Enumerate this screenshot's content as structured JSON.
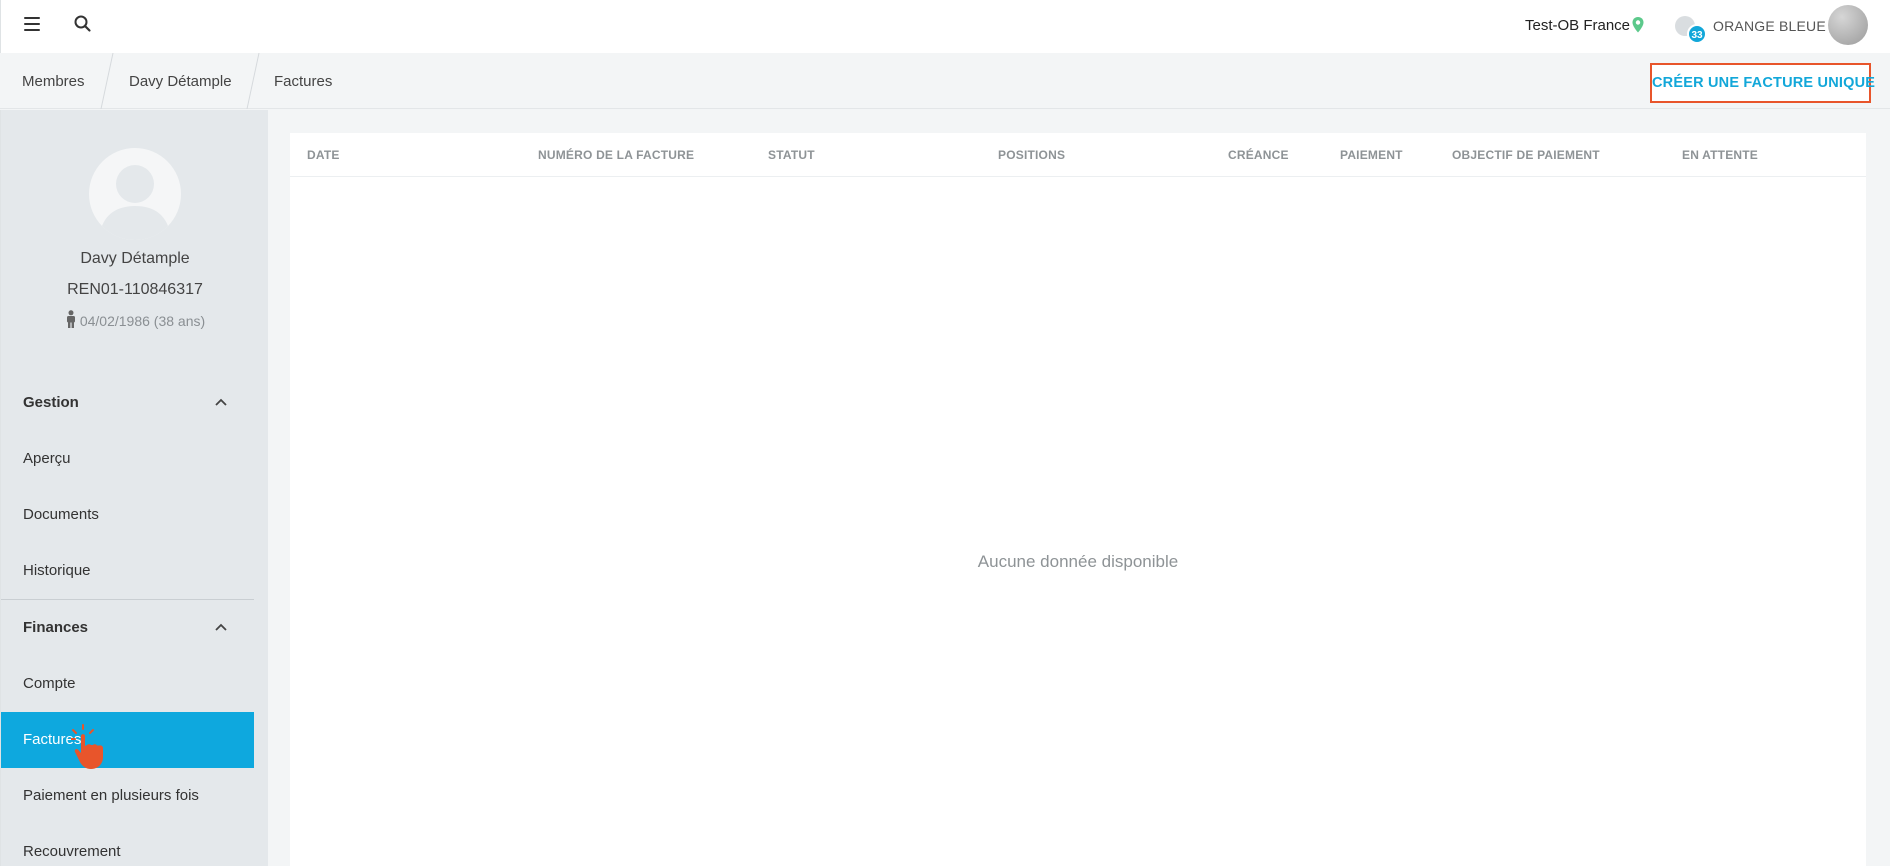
{
  "topbar": {
    "studio_name": "Test-OB France",
    "notification_count": "33",
    "brand_name": "ORANGE BLEUE",
    "icons": [
      "hamburger-menu-icon",
      "search-icon",
      "location-pin-icon",
      "notification-cloud-icon",
      "user-avatar"
    ],
    "pin_color": "#5cc98b"
  },
  "breadcrumb": {
    "items": [
      "Membres",
      "Davy Détample",
      "Factures"
    ]
  },
  "actions": {
    "create_invoice_label": "CRÉER UNE FACTURE UNIQUE",
    "accent_color": "#12a7d9",
    "highlight_color": "#e8552b"
  },
  "profile": {
    "name": "Davy Détample",
    "member_id": "REN01-110846317",
    "birthdate": "04/02/1986 (38 ans)"
  },
  "sidebar": {
    "sections": [
      {
        "title": "Gestion",
        "expanded": true,
        "items": [
          "Aperçu",
          "Documents",
          "Historique"
        ]
      },
      {
        "title": "Finances",
        "expanded": true,
        "items": [
          "Compte",
          "Factures",
          "Paiement en plusieurs fois",
          "Recouvrement"
        ]
      }
    ],
    "active_item": "Factures",
    "active_color": "#0ea8de"
  },
  "table": {
    "columns": [
      "DATE",
      "NUMÉRO DE LA FACTURE",
      "STATUT",
      "POSITIONS",
      "CRÉANCE",
      "PAIEMENT",
      "OBJECTIF DE PAIEMENT",
      "EN ATTENTE"
    ],
    "rows": [],
    "empty_message": "Aucune donnée disponible"
  }
}
